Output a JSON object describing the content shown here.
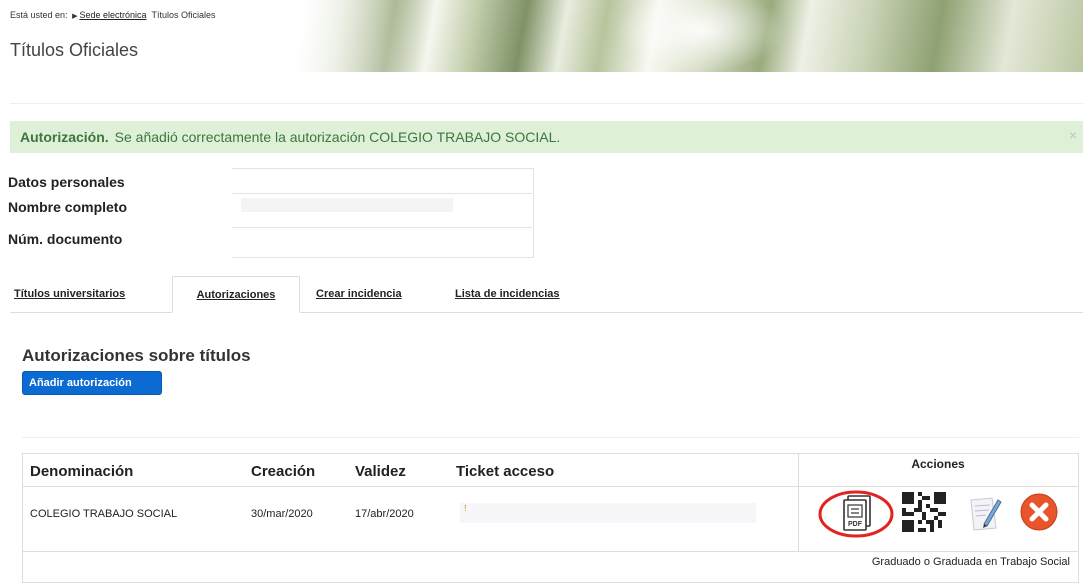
{
  "breadcrumb": {
    "prefix": "Está usted en:",
    "link": "Sede electrónica",
    "current": "Títulos Oficiales"
  },
  "page_title": "Títulos Oficiales",
  "alert": {
    "title": "Autorización.",
    "message": "Se añadió correctamente la autorización COLEGIO TRABAJO SOCIAL.",
    "close": "×"
  },
  "personal": {
    "heading": "Datos personales",
    "name_label": "Nombre completo",
    "doc_label": "Núm. documento"
  },
  "tabs": [
    {
      "label": "Títulos universitarios"
    },
    {
      "label": "Autorizaciones",
      "active": true
    },
    {
      "label": "Crear incidencia"
    },
    {
      "label": "Lista de incidencias"
    }
  ],
  "section": {
    "title": "Autorizaciones sobre títulos",
    "add_button": "Añadir autorización"
  },
  "table": {
    "headers": {
      "name": "Denominación",
      "created": "Creación",
      "valid": "Validez",
      "ticket": "Ticket acceso",
      "actions": "Acciones"
    },
    "rows": [
      {
        "name": "COLEGIO TRABAJO SOCIAL",
        "created": "30/mar/2020",
        "valid": "17/abr/2020",
        "ticket": "!"
      }
    ],
    "footer_note": "Graduado o Graduada en Trabajo Social"
  },
  "actions": [
    {
      "icon": "pdf-document-icon"
    },
    {
      "icon": "qr-code-icon"
    },
    {
      "icon": "edit-pencil-icon"
    },
    {
      "icon": "delete-x-icon"
    }
  ],
  "colors": {
    "alert_bg": "#dff0d8",
    "alert_text": "#3c763d",
    "button": "#0c6bd3",
    "delete": "#e8552b",
    "highlight_circle": "#e2241f"
  }
}
